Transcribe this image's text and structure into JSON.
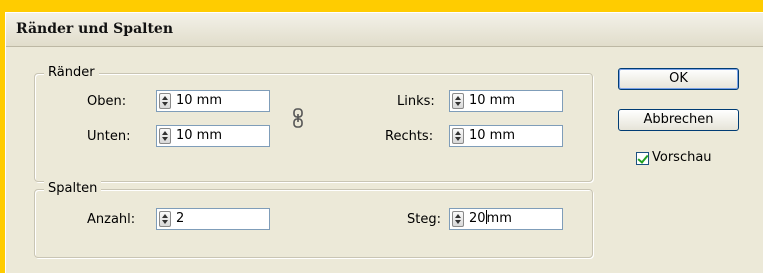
{
  "dialog": {
    "title": "Ränder und Spalten"
  },
  "margins": {
    "legend": "Ränder",
    "top_label": "Oben:",
    "top_value": "10 mm",
    "bottom_label": "Unten:",
    "bottom_value": "10 mm",
    "left_label": "Links:",
    "left_value": "10 mm",
    "right_label": "Rechts:",
    "right_value": "10 mm",
    "link_icon": "chain-link-icon"
  },
  "columns": {
    "legend": "Spalten",
    "count_label": "Anzahl:",
    "count_value": "2",
    "gutter_label": "Steg:",
    "gutter_value_before_caret": "20",
    "gutter_value_after_caret": "mm"
  },
  "buttons": {
    "ok_label": "OK",
    "cancel_label": "Abbrechen"
  },
  "preview": {
    "label": "Vorschau",
    "checked": true
  },
  "colors": {
    "background": "#ffcc00",
    "dialog": "#ece9d8",
    "field_border": "#7f9db9",
    "button_border": "#003c74",
    "check": "#21a121"
  }
}
